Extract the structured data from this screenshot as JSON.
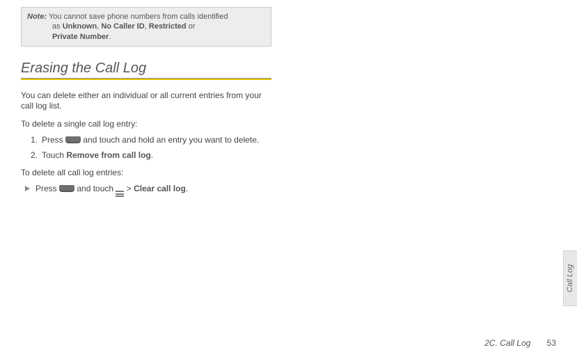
{
  "note": {
    "label": "Note:",
    "text1": "You cannot save phone numbers from calls identified",
    "text2": "as ",
    "bold1": "Unknown",
    "sep1": ", ",
    "bold2": "No Caller ID",
    "sep2": ", ",
    "bold3": "Restricted",
    "or": " or",
    "bold4": "Private Number",
    "period": "."
  },
  "section": {
    "title": "Erasing the Call Log"
  },
  "intro": "You can delete either an individual or all current entries from your call log list.",
  "sub1": "To delete a single call log entry:",
  "steps": {
    "s1num": "1.",
    "s1a": "Press ",
    "s1b": " and touch and hold an entry you want to delete.",
    "s2num": "2.",
    "s2a": "Touch ",
    "s2bold": "Remove from call log",
    "s2dot": "."
  },
  "sub2": "To delete all call log entries:",
  "bullet": {
    "a": "Press ",
    "b": " and touch ",
    "gt": " > ",
    "bold": "Clear call log",
    "dot": "."
  },
  "sidetab": "Call Log",
  "footer": {
    "section": "2C. Call Log",
    "page": "53"
  }
}
